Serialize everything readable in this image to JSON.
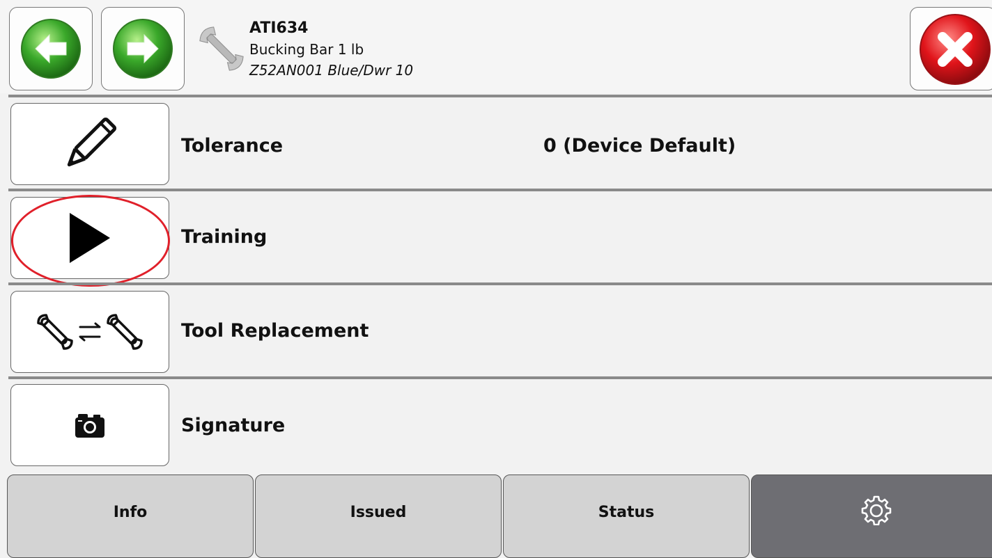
{
  "header": {
    "tool_id": "ATI634",
    "tool_name": "Bucking Bar 1 lb",
    "tool_location": "Z52AN001 Blue/Dwr 10",
    "icons": {
      "back": "left-arrow-green-icon",
      "forward": "right-arrow-green-icon",
      "tool": "wrench-icon",
      "close": "close-red-x-icon"
    }
  },
  "rows": [
    {
      "label": "Tolerance",
      "value": "0 (Device Default)",
      "icon": "pencil-icon"
    },
    {
      "label": "Training",
      "value": "",
      "icon": "play-icon",
      "highlighted": true
    },
    {
      "label": "Tool Replacement",
      "value": "",
      "icon": "wrench-swap-icon"
    },
    {
      "label": "Signature",
      "value": "",
      "icon": "camera-icon"
    }
  ],
  "tabs": [
    {
      "label": "Info"
    },
    {
      "label": "Issued"
    },
    {
      "label": "Status"
    },
    {
      "label": "",
      "icon": "gear-icon",
      "active": true
    }
  ],
  "colors": {
    "highlight_ring": "#e0202a",
    "active_tab": "#6e6e73",
    "tab": "#d3d3d3",
    "separator": "#8a8a8a"
  }
}
